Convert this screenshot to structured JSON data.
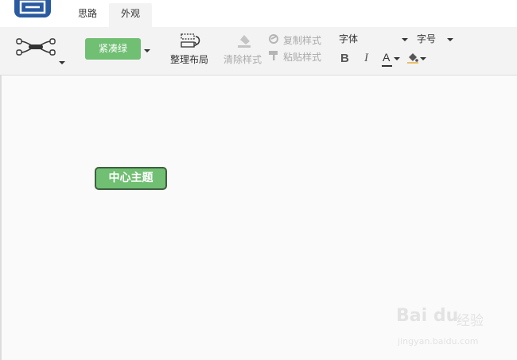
{
  "tabs": [
    {
      "label": "思路",
      "active": false
    },
    {
      "label": "外观",
      "active": true
    }
  ],
  "toolbar": {
    "theme_label": "紧凑绿",
    "arrange_label": "整理布局",
    "clear_style_label": "清除样式",
    "copy_style_label": "复制样式",
    "paste_style_label": "粘贴样式",
    "font_label": "字体",
    "font_size_label": "字号",
    "bold_label": "B",
    "italic_label": "I",
    "font_color_label": "A"
  },
  "canvas": {
    "central_topic": "中心主题"
  },
  "watermark": {
    "brand": "Bai du",
    "cn": "经验",
    "url": "jingyan.baidu.com"
  },
  "colors": {
    "accent": "#70bf73",
    "topic_border": "#3f5f40",
    "logo": "#2a5aa0",
    "font_color_bar": "#333333"
  },
  "icons": [
    "app-logo-icon",
    "structure-icon",
    "arrange-layout-icon",
    "clear-style-icon",
    "copy-style-icon",
    "paste-style-icon",
    "paint-bucket-icon"
  ]
}
